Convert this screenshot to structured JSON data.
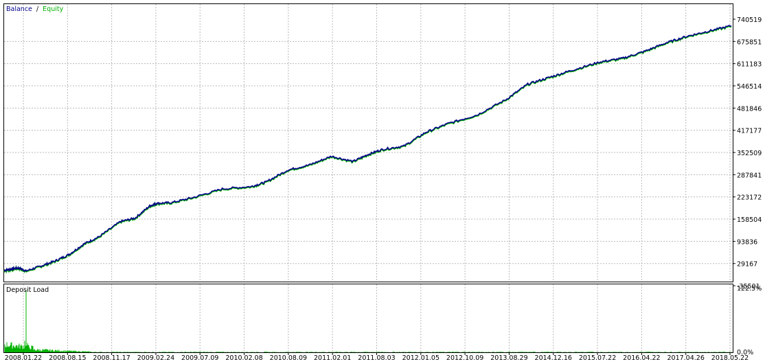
{
  "chart_data": {
    "type": "line",
    "main_pane": {
      "legend": [
        "Balance",
        "Equity"
      ],
      "legend_separator": "/",
      "series_colors": {
        "Balance": "#00008b",
        "Equity": "#00b000"
      },
      "y_ticks": [
        "740519",
        "675851",
        "611183",
        "546514",
        "481846",
        "417177",
        "352509",
        "287841",
        "223172",
        "158504",
        "93836",
        "29167",
        "-35501"
      ],
      "ylim": [
        -35501,
        740519
      ],
      "x": [
        0,
        0.01,
        0.02,
        0.03,
        0.05,
        0.07,
        0.09,
        0.11,
        0.13,
        0.16,
        0.18,
        0.2,
        0.21,
        0.23,
        0.26,
        0.3,
        0.34,
        0.36,
        0.39,
        0.42,
        0.45,
        0.48,
        0.5,
        0.52,
        0.55,
        0.58,
        0.61,
        0.65,
        0.69,
        0.72,
        0.75,
        0.78,
        0.82,
        0.85,
        0.88,
        0.91,
        0.94,
        0.97,
        1.0
      ],
      "balance": [
        8000,
        12000,
        15000,
        6000,
        20000,
        35000,
        55000,
        85000,
        105000,
        150000,
        160000,
        195000,
        203000,
        205000,
        220000,
        245000,
        252000,
        265000,
        300000,
        315000,
        340000,
        325000,
        345000,
        360000,
        370000,
        410000,
        435000,
        460000,
        505000,
        550000,
        570000,
        590000,
        615000,
        625000,
        645000,
        670000,
        690000,
        705000,
        720000
      ]
    },
    "deposit_pane": {
      "title": "Deposit Load",
      "y_ticks": [
        "122.5%",
        "0.0%"
      ],
      "ylim": [
        0,
        122.5
      ],
      "color": "#00b000"
    },
    "x_ticks": [
      "2008.01.22",
      "2008.08.15",
      "2008.11.17",
      "2009.02.24",
      "2009.07.09",
      "2010.02.08",
      "2010.08.09",
      "2011.02.01",
      "2011.08.03",
      "2012.01.05",
      "2012.10.09",
      "2013.08.29",
      "2014.12.16",
      "2015.07.22",
      "2016.04.22",
      "2017.04.26",
      "2018.05.22"
    ],
    "grid": true
  }
}
